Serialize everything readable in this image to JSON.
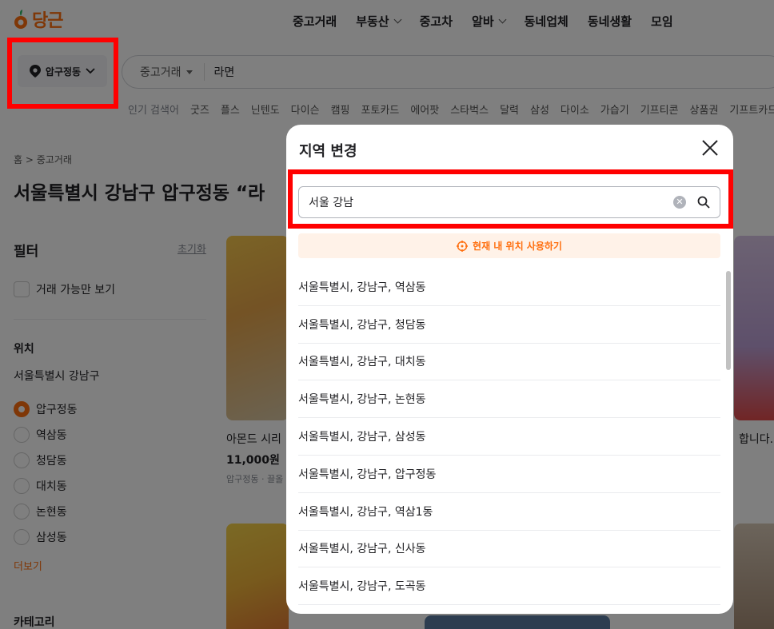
{
  "header": {
    "logo_text": "당근",
    "nav": [
      {
        "label": "중고거래",
        "dropdown": false
      },
      {
        "label": "부동산",
        "dropdown": true
      },
      {
        "label": "중고차",
        "dropdown": false
      },
      {
        "label": "알바",
        "dropdown": true
      },
      {
        "label": "동네업체",
        "dropdown": false
      },
      {
        "label": "동네생활",
        "dropdown": false
      },
      {
        "label": "모임",
        "dropdown": false
      }
    ],
    "location_button": "압구정동",
    "search": {
      "category": "중고거래",
      "value": "라면"
    },
    "popular_label": "인기 검색어",
    "popular": [
      "굿즈",
      "플스",
      "닌텐도",
      "다이슨",
      "캠핑",
      "포토카드",
      "에어팟",
      "스타벅스",
      "달력",
      "삼성",
      "다이소",
      "가습기",
      "기프티콘",
      "상품권",
      "기프트카드"
    ]
  },
  "page": {
    "breadcrumb_home": "홈",
    "breadcrumb_sep": ">",
    "breadcrumb_current": "중고거래",
    "title": "서울특별시 강남구 압구정동 “라"
  },
  "filter": {
    "title": "필터",
    "reset": "초기화",
    "available_only": "거래 가능만 보기",
    "location_title": "위치",
    "region": "서울특별시 강남구",
    "options": [
      {
        "label": "압구정동",
        "selected": true
      },
      {
        "label": "역삼동",
        "selected": false
      },
      {
        "label": "청담동",
        "selected": false
      },
      {
        "label": "대치동",
        "selected": false
      },
      {
        "label": "논현동",
        "selected": false
      },
      {
        "label": "삼성동",
        "selected": false
      }
    ],
    "more": "더보기",
    "category_title": "카테고리"
  },
  "cards": {
    "first_title": "아몬드 시리",
    "first_price": "11,000원",
    "first_meta": "압구정동 · 끌올",
    "second_title_tail": "합니다."
  },
  "modal": {
    "title": "지역 변경",
    "input_value": "서울 강남",
    "current_location": "현재 내 위치 사용하기",
    "results": [
      "서울특별시, 강남구, 역삼동",
      "서울특별시, 강남구, 청담동",
      "서울특별시, 강남구, 대치동",
      "서울특별시, 강남구, 논현동",
      "서울특별시, 강남구, 삼성동",
      "서울특별시, 강남구, 압구정동",
      "서울특별시, 강남구, 역삼1동",
      "서울특별시, 강남구, 신사동",
      "서울특별시, 강남구, 도곡동"
    ]
  },
  "colors": {
    "brand": "#ff6f0f",
    "highlight": "#ff0000"
  }
}
